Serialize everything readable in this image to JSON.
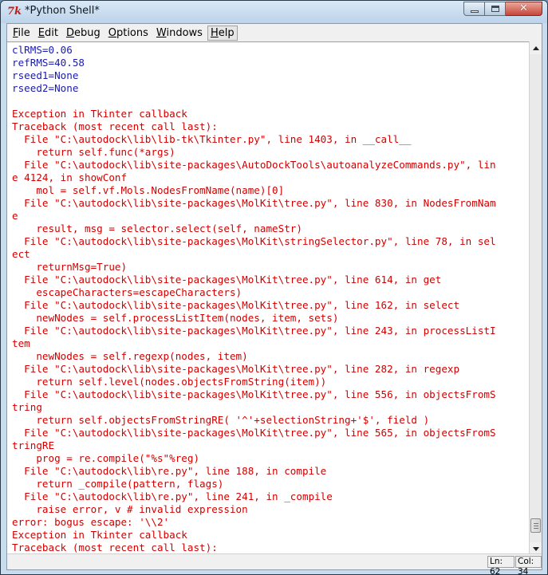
{
  "window": {
    "title": "*Python Shell*",
    "icon": "tk-feather-icon",
    "controls": {
      "minimize": "minimize",
      "maximize": "maximize",
      "close": "close"
    }
  },
  "menu": {
    "items": [
      {
        "label": "File",
        "accel": "F"
      },
      {
        "label": "Edit",
        "accel": "E"
      },
      {
        "label": "Debug",
        "accel": "D"
      },
      {
        "label": "Options",
        "accel": "O"
      },
      {
        "label": "Windows",
        "accel": "W"
      },
      {
        "label": "Help",
        "accel": "H"
      }
    ]
  },
  "shell": {
    "lines": [
      {
        "text": "clRMS=0.06",
        "color": "blue"
      },
      {
        "text": "refRMS=40.58",
        "color": "blue"
      },
      {
        "text": "rseed1=None",
        "color": "blue"
      },
      {
        "text": "rseed2=None",
        "color": "blue"
      },
      {
        "text": "",
        "color": "blue"
      },
      {
        "text": "Exception in Tkinter callback",
        "color": "red"
      },
      {
        "text": "Traceback (most recent call last):",
        "color": "red"
      },
      {
        "text": "  File \"C:\\autodock\\lib\\lib-tk\\Tkinter.py\", line 1403, in __call__",
        "color": "red"
      },
      {
        "text": "    return self.func(*args)",
        "color": "red"
      },
      {
        "text": "  File \"C:\\autodock\\lib\\site-packages\\AutoDockTools\\autoanalyzeCommands.py\", lin",
        "color": "red"
      },
      {
        "text": "e 4124, in showConf",
        "color": "red"
      },
      {
        "text": "    mol = self.vf.Mols.NodesFromName(name)[0]",
        "color": "red"
      },
      {
        "text": "  File \"C:\\autodock\\lib\\site-packages\\MolKit\\tree.py\", line 830, in NodesFromNam",
        "color": "red"
      },
      {
        "text": "e",
        "color": "red"
      },
      {
        "text": "    result, msg = selector.select(self, nameStr)",
        "color": "red"
      },
      {
        "text": "  File \"C:\\autodock\\lib\\site-packages\\MolKit\\stringSelector.py\", line 78, in sel",
        "color": "red"
      },
      {
        "text": "ect",
        "color": "red"
      },
      {
        "text": "    returnMsg=True)",
        "color": "red"
      },
      {
        "text": "  File \"C:\\autodock\\lib\\site-packages\\MolKit\\tree.py\", line 614, in get",
        "color": "red"
      },
      {
        "text": "    escapeCharacters=escapeCharacters)",
        "color": "red"
      },
      {
        "text": "  File \"C:\\autodock\\lib\\site-packages\\MolKit\\tree.py\", line 162, in select",
        "color": "red"
      },
      {
        "text": "    newNodes = self.processListItem(nodes, item, sets)",
        "color": "red"
      },
      {
        "text": "  File \"C:\\autodock\\lib\\site-packages\\MolKit\\tree.py\", line 243, in processListI",
        "color": "red"
      },
      {
        "text": "tem",
        "color": "red"
      },
      {
        "text": "    newNodes = self.regexp(nodes, item)",
        "color": "red"
      },
      {
        "text": "  File \"C:\\autodock\\lib\\site-packages\\MolKit\\tree.py\", line 282, in regexp",
        "color": "red"
      },
      {
        "text": "    return self.level(nodes.objectsFromString(item))",
        "color": "red"
      },
      {
        "text": "  File \"C:\\autodock\\lib\\site-packages\\MolKit\\tree.py\", line 556, in objectsFromS",
        "color": "red"
      },
      {
        "text": "tring",
        "color": "red"
      },
      {
        "text": "    return self.objectsFromStringRE( '^'+selectionString+'$', field )",
        "color": "red"
      },
      {
        "text": "  File \"C:\\autodock\\lib\\site-packages\\MolKit\\tree.py\", line 565, in objectsFromS",
        "color": "red"
      },
      {
        "text": "tringRE",
        "color": "red"
      },
      {
        "text": "    prog = re.compile(\"%s\"%reg)",
        "color": "red"
      },
      {
        "text": "  File \"C:\\autodock\\lib\\re.py\", line 188, in compile",
        "color": "red"
      },
      {
        "text": "    return _compile(pattern, flags)",
        "color": "red"
      },
      {
        "text": "  File \"C:\\autodock\\lib\\re.py\", line 241, in _compile",
        "color": "red"
      },
      {
        "text": "    raise error, v # invalid expression",
        "color": "red"
      },
      {
        "text": "error: bogus escape: '\\\\2'",
        "color": "red"
      },
      {
        "text": "Exception in Tkinter callback",
        "color": "red"
      },
      {
        "text": "Traceback (most recent call last):",
        "color": "red"
      }
    ],
    "colors": {
      "blue": "#1a1aaf",
      "red": "#d10000"
    },
    "scroll_position": 0.98
  },
  "status": {
    "line": "Ln: 62",
    "col": "Col: 34"
  }
}
